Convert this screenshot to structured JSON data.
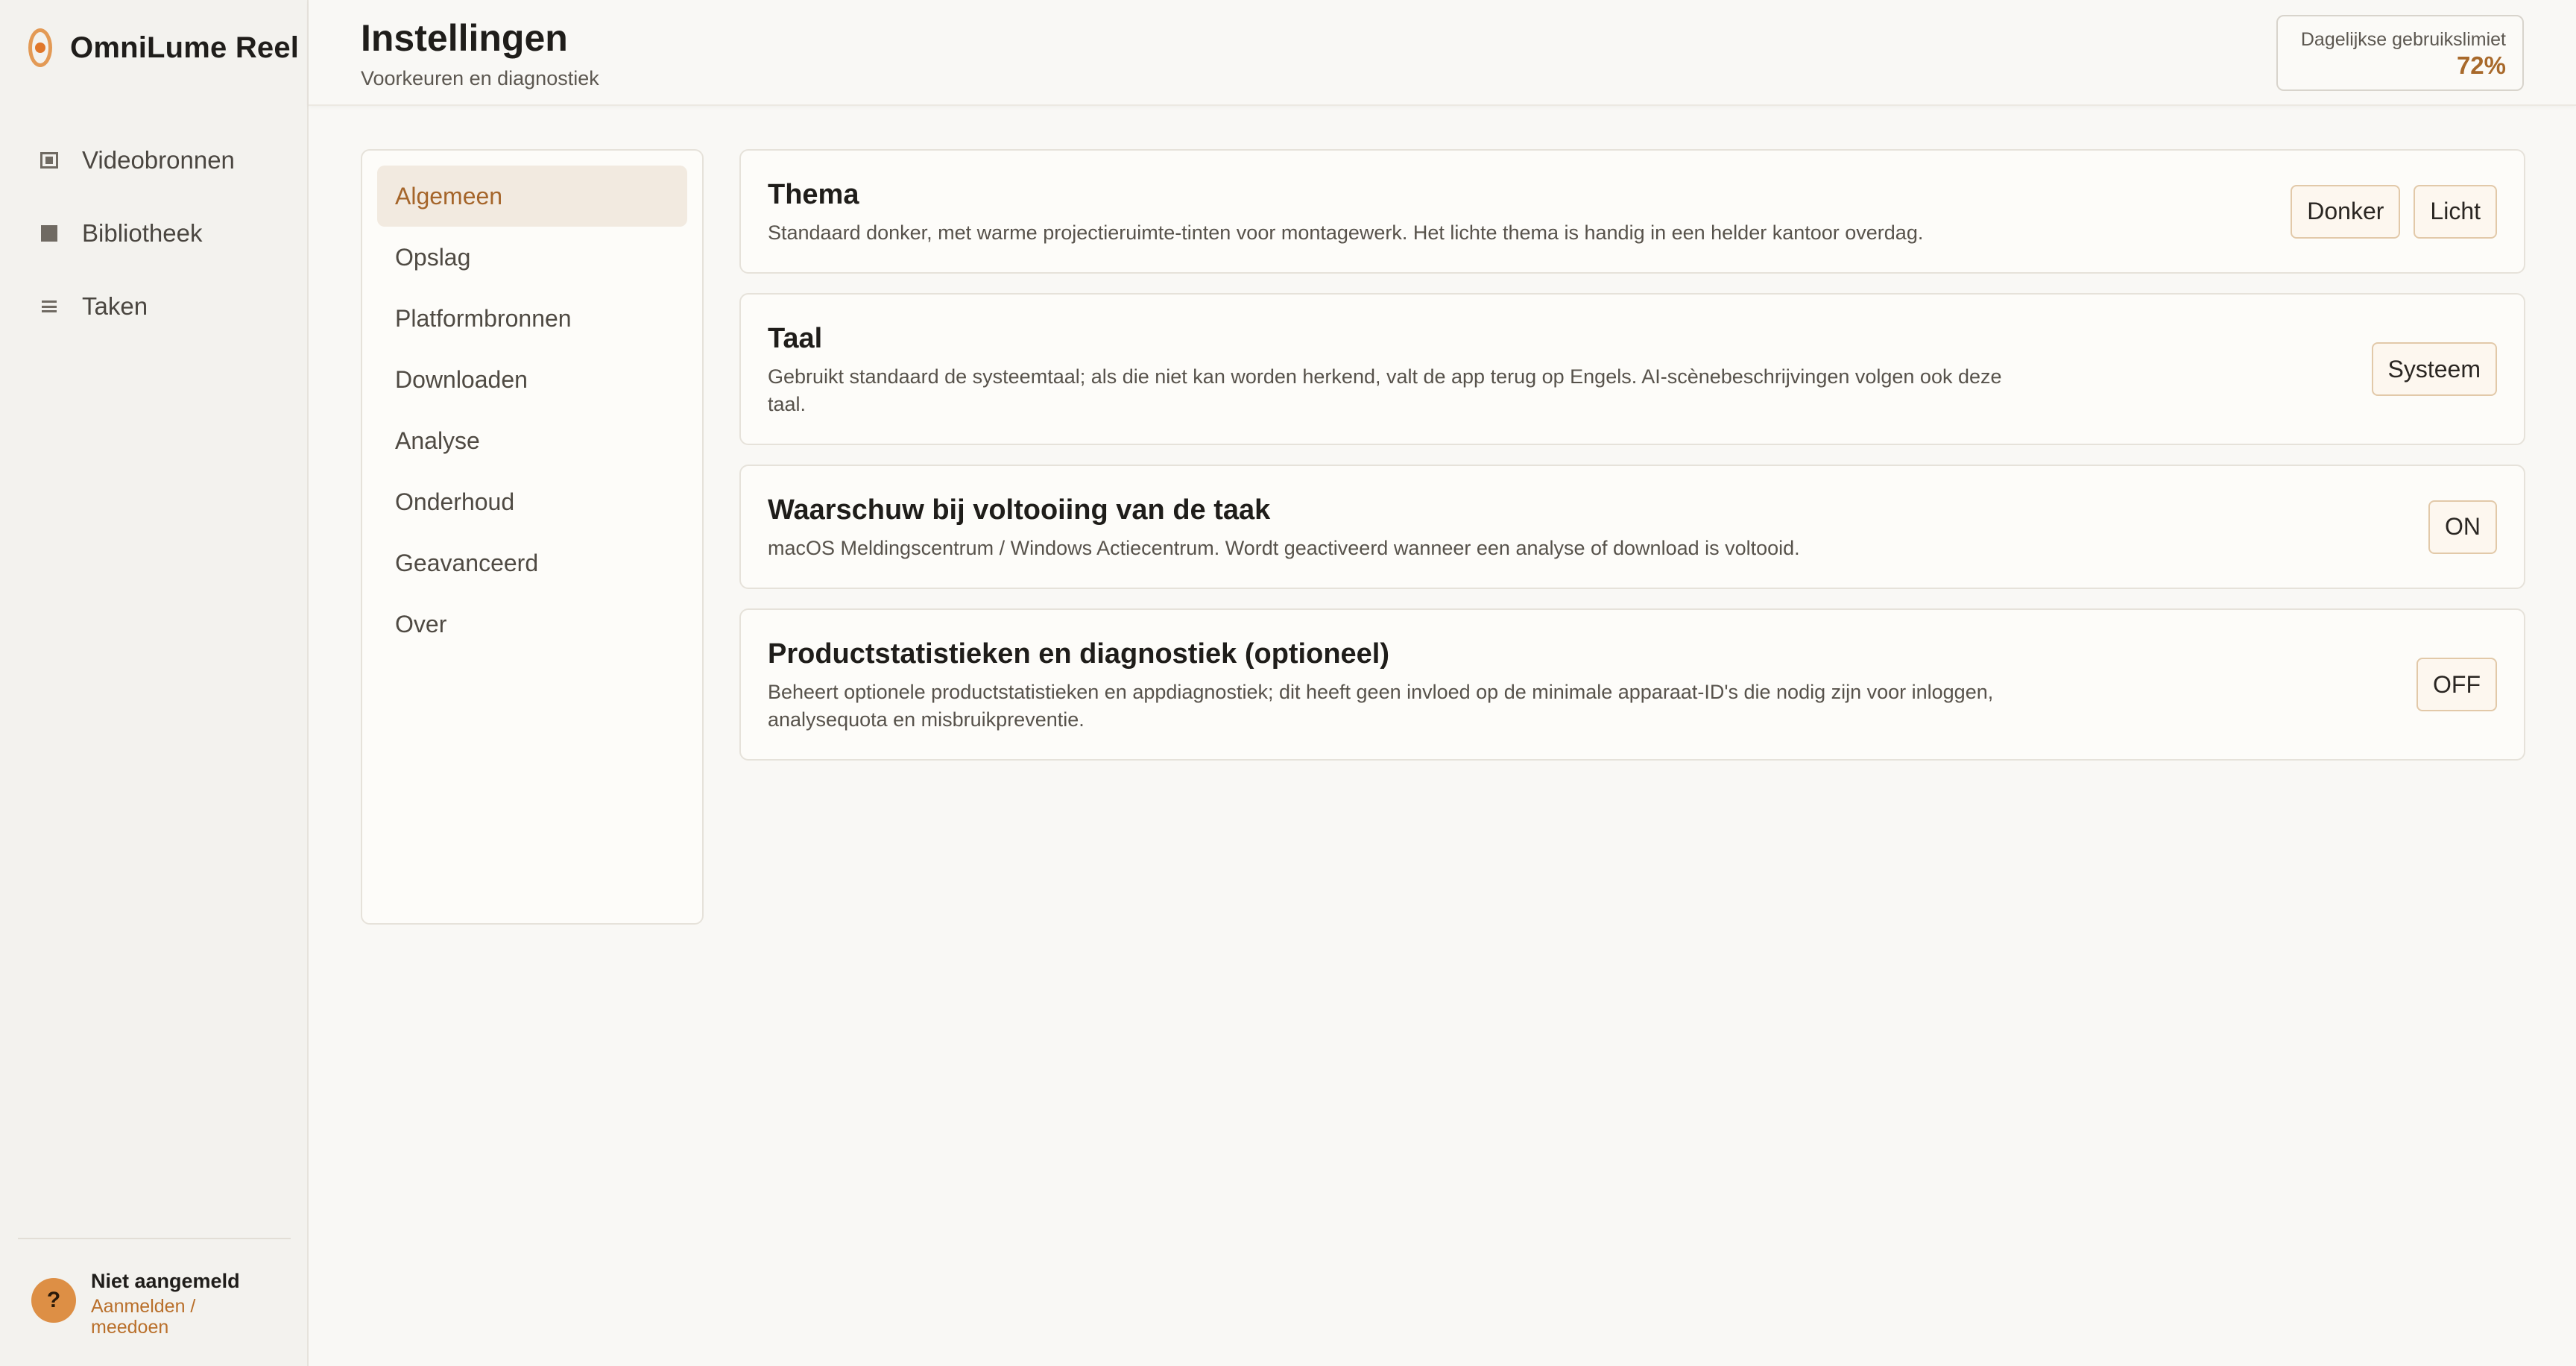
{
  "app": {
    "name": "OmniLume Reel"
  },
  "sidebar": {
    "items": [
      {
        "label": "Videobronnen",
        "icon": "video-source-icon"
      },
      {
        "label": "Bibliotheek",
        "icon": "library-icon"
      },
      {
        "label": "Taken",
        "icon": "tasks-icon"
      }
    ],
    "account": {
      "avatar": "?",
      "status": "Niet aangemeld",
      "link": "Aanmelden / meedoen"
    }
  },
  "header": {
    "title": "Instellingen",
    "subtitle": "Voorkeuren en diagnostiek",
    "usage": {
      "label": "Dagelijkse gebruikslimiet",
      "value": "72%"
    }
  },
  "settings_menu": {
    "items": [
      "Algemeen",
      "Opslag",
      "Platformbronnen",
      "Downloaden",
      "Analyse",
      "Onderhoud",
      "Geavanceerd",
      "Over"
    ],
    "active": "Algemeen"
  },
  "cards": {
    "theme": {
      "title": "Thema",
      "description": "Standaard donker, met warme projectieruimte-tinten voor montagewerk. Het lichte thema is handig in een helder kantoor overdag.",
      "buttons": [
        "Donker",
        "Licht"
      ]
    },
    "language": {
      "title": "Taal",
      "description": "Gebruikt standaard de systeemtaal; als die niet kan worden herkend, valt de app terug op Engels. AI-scènebeschrijvingen volgen ook deze taal.",
      "button": "Systeem"
    },
    "notify": {
      "title": "Waarschuw bij voltooiing van de taak",
      "description": "macOS Meldingscentrum / Windows Actiecentrum. Wordt geactiveerd wanneer een analyse of download is voltooid.",
      "toggle": "ON"
    },
    "diagnostics": {
      "title": "Productstatistieken en diagnostiek (optioneel)",
      "description": "Beheert optionele productstatistieken en appdiagnostiek; dit heeft geen invloed op de minimale apparaat-ID's die nodig zijn voor inloggen, analysequota en misbruikpreventie.",
      "toggle": "OFF"
    }
  },
  "colors": {
    "accent": "#a8692b",
    "avatar": "#dd8f45",
    "active_menu_bg": "#f2eae0"
  }
}
